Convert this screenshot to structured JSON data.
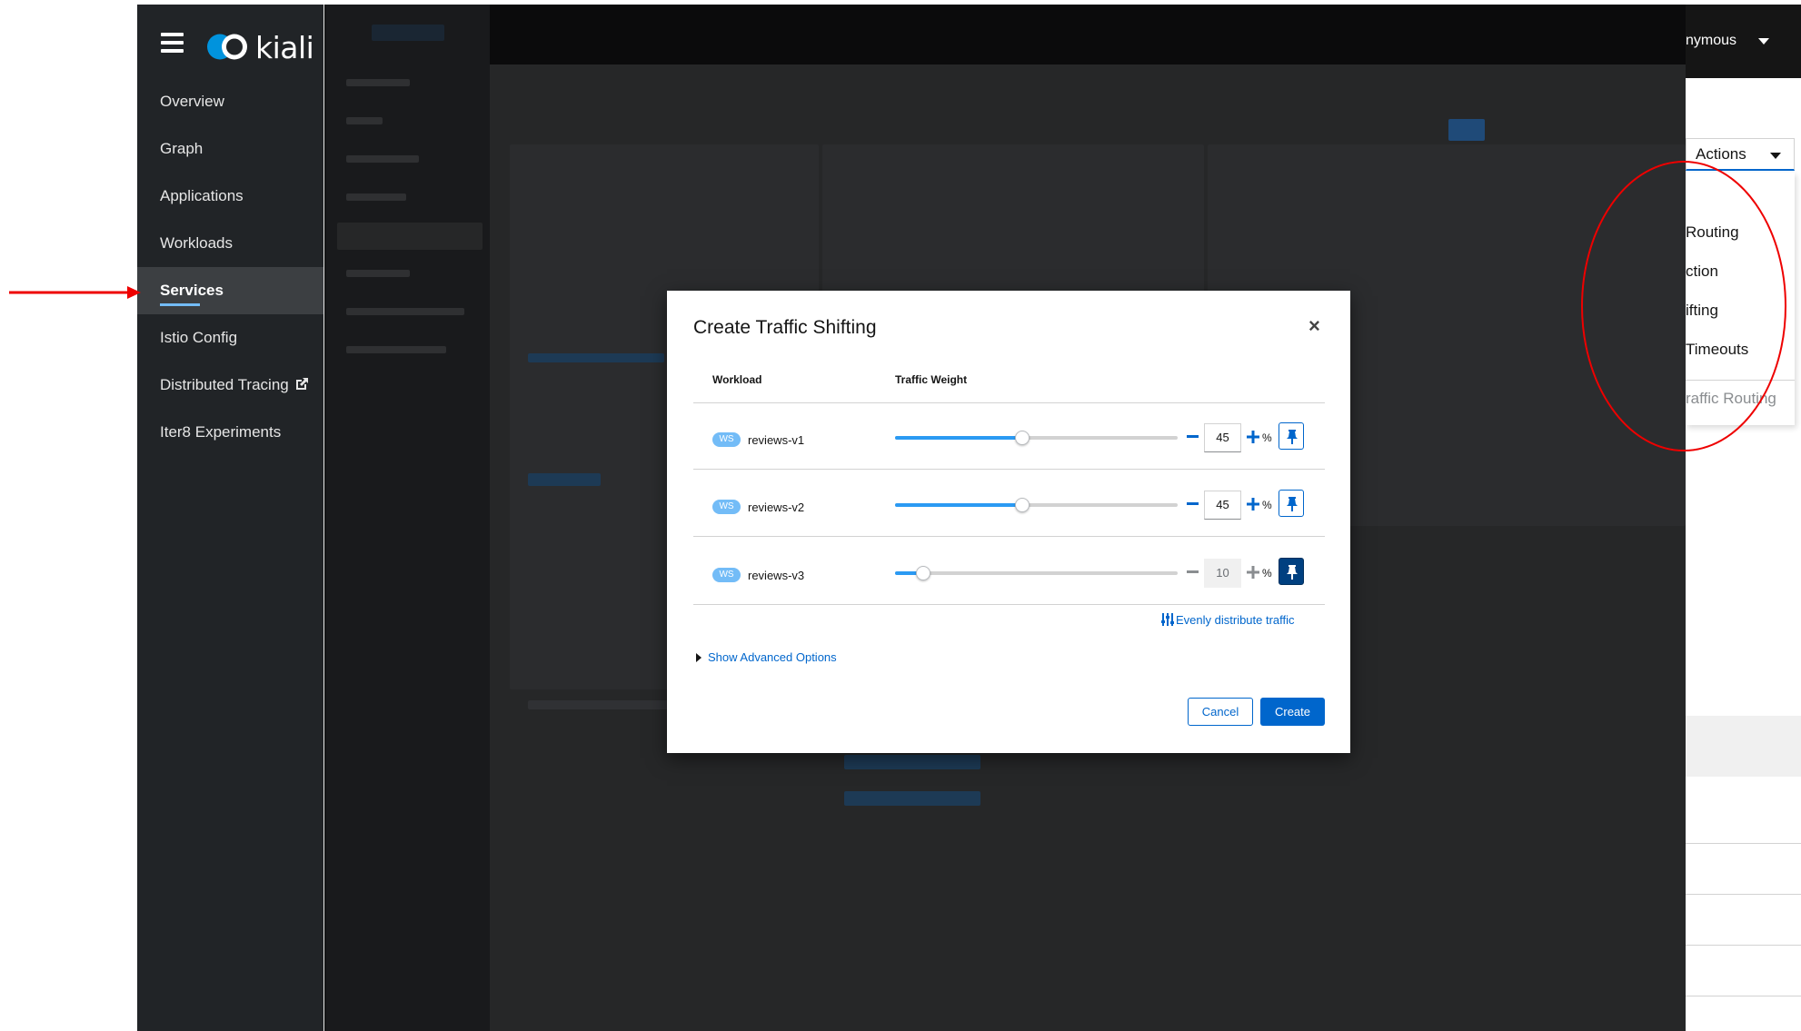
{
  "brand": {
    "logo_text": "kiali"
  },
  "nav": {
    "items": [
      {
        "label": "Overview"
      },
      {
        "label": "Graph"
      },
      {
        "label": "Applications"
      },
      {
        "label": "Workloads"
      },
      {
        "label": "Services"
      },
      {
        "label": "Istio Config"
      },
      {
        "label": "Distributed Tracing"
      },
      {
        "label": "Iter8 Experiments"
      }
    ],
    "active": "Services"
  },
  "header": {
    "user_label": "nymous"
  },
  "actions": {
    "button_label": "Actions",
    "menu": [
      {
        "label": "Routing"
      },
      {
        "label": "ction"
      },
      {
        "label": "ifting"
      },
      {
        "label": "Timeouts"
      },
      {
        "label": "raffic Routing",
        "disabled": true
      }
    ]
  },
  "modal": {
    "title": "Create Traffic Shifting",
    "close_icon": "×",
    "columns": {
      "workload": "Workload",
      "weight": "Traffic Weight"
    },
    "rows": [
      {
        "badge": "WS",
        "name": "reviews-v1",
        "weight": "45",
        "weight_fraction": 0.45,
        "percent_sign": "%",
        "locked": false
      },
      {
        "badge": "WS",
        "name": "reviews-v2",
        "weight": "45",
        "weight_fraction": 0.45,
        "percent_sign": "%",
        "locked": false
      },
      {
        "badge": "WS",
        "name": "reviews-v3",
        "weight": "10",
        "weight_fraction": 0.1,
        "percent_sign": "%",
        "locked": true
      }
    ],
    "evenly_label": "Evenly distribute traffic",
    "advanced_label": "Show Advanced Options",
    "cancel_label": "Cancel",
    "create_label": "Create"
  },
  "colors": {
    "sidebar_bg": "#212427",
    "accent_blue": "#0066cc",
    "slider_fill": "#2b9af3",
    "annotation_red": "#ee0000"
  },
  "icons": [
    "hamburger-icon",
    "kiali-logo-icon",
    "external-link-icon",
    "caret-down-icon",
    "close-icon",
    "minus-icon",
    "plus-icon",
    "thumbtack-icon",
    "sliders-icon",
    "angle-right-icon"
  ]
}
